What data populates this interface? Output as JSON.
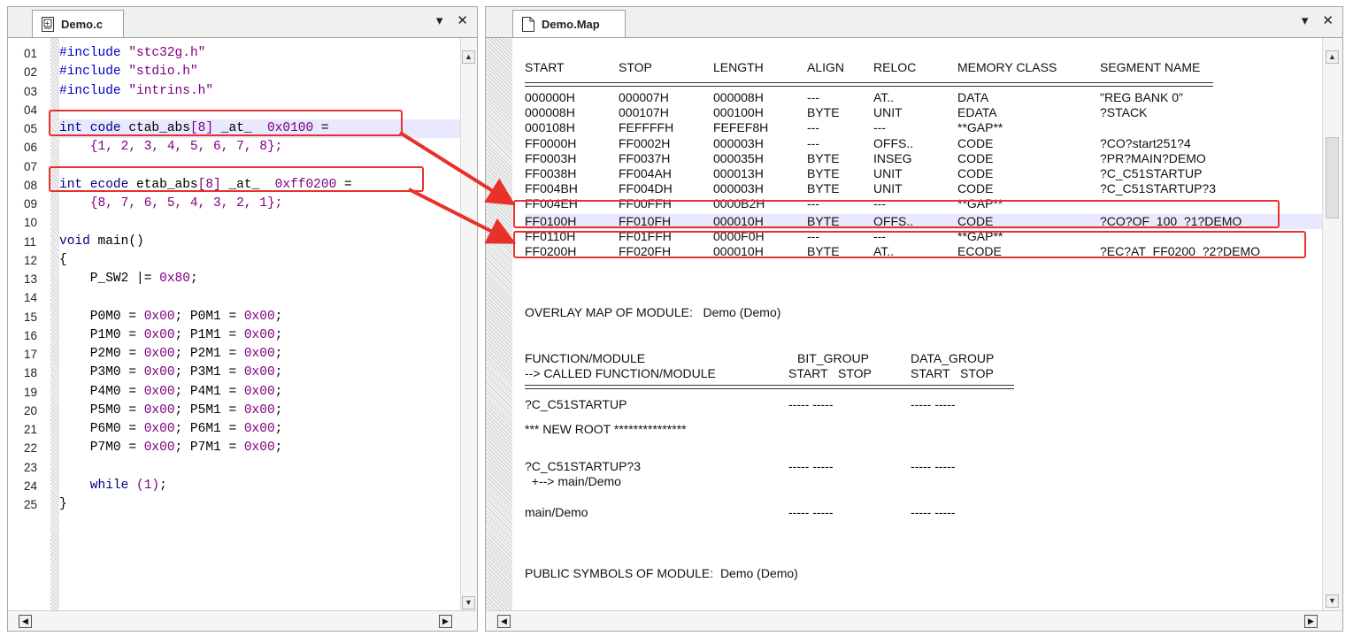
{
  "left_pane": {
    "tab_title": "Demo.c",
    "code_lines": [
      {
        "n": "01",
        "parts": [
          [
            "pp",
            "#include "
          ],
          [
            "str",
            "\"stc32g.h\""
          ]
        ]
      },
      {
        "n": "02",
        "parts": [
          [
            "pp",
            "#include "
          ],
          [
            "str",
            "\"stdio.h\""
          ]
        ]
      },
      {
        "n": "03",
        "parts": [
          [
            "pp",
            "#include "
          ],
          [
            "str",
            "\"intrins.h\""
          ]
        ]
      },
      {
        "n": "04",
        "parts": []
      },
      {
        "n": "05",
        "parts": [
          [
            "kw",
            "int code "
          ],
          [
            "",
            "ctab_abs"
          ],
          [
            "num",
            "[8]"
          ],
          [
            "",
            " _at_ "
          ],
          [
            "num",
            " 0x0100"
          ],
          [
            "",
            " ="
          ]
        ]
      },
      {
        "n": "06",
        "parts": [
          [
            "",
            "    "
          ],
          [
            "num",
            "{1, 2, 3, 4, 5, 6, 7, 8};"
          ]
        ]
      },
      {
        "n": "07",
        "parts": []
      },
      {
        "n": "08",
        "parts": [
          [
            "kw",
            "int ecode "
          ],
          [
            "",
            "etab_abs"
          ],
          [
            "num",
            "[8]"
          ],
          [
            "",
            " _at_ "
          ],
          [
            "num",
            " 0xff0200"
          ],
          [
            "",
            " ="
          ]
        ]
      },
      {
        "n": "09",
        "parts": [
          [
            "",
            "    "
          ],
          [
            "num",
            "{8, 7, 6, 5, 4, 3, 2, 1};"
          ]
        ]
      },
      {
        "n": "10",
        "parts": []
      },
      {
        "n": "11",
        "parts": [
          [
            "kw",
            "void "
          ],
          [
            "",
            "main()"
          ]
        ]
      },
      {
        "n": "12",
        "parts": [
          [
            "",
            "{"
          ]
        ]
      },
      {
        "n": "13",
        "parts": [
          [
            "",
            "    P_SW2 |= "
          ],
          [
            "num",
            "0x80"
          ],
          [
            "",
            ";"
          ]
        ]
      },
      {
        "n": "14",
        "parts": []
      },
      {
        "n": "15",
        "parts": [
          [
            "",
            "    P0M0 = "
          ],
          [
            "num",
            "0x00"
          ],
          [
            "",
            "; P0M1 = "
          ],
          [
            "num",
            "0x00"
          ],
          [
            "",
            ";"
          ]
        ]
      },
      {
        "n": "16",
        "parts": [
          [
            "",
            "    P1M0 = "
          ],
          [
            "num",
            "0x00"
          ],
          [
            "",
            "; P1M1 = "
          ],
          [
            "num",
            "0x00"
          ],
          [
            "",
            ";"
          ]
        ]
      },
      {
        "n": "17",
        "parts": [
          [
            "",
            "    P2M0 = "
          ],
          [
            "num",
            "0x00"
          ],
          [
            "",
            "; P2M1 = "
          ],
          [
            "num",
            "0x00"
          ],
          [
            "",
            ";"
          ]
        ]
      },
      {
        "n": "18",
        "parts": [
          [
            "",
            "    P3M0 = "
          ],
          [
            "num",
            "0x00"
          ],
          [
            "",
            "; P3M1 = "
          ],
          [
            "num",
            "0x00"
          ],
          [
            "",
            ";"
          ]
        ]
      },
      {
        "n": "19",
        "parts": [
          [
            "",
            "    P4M0 = "
          ],
          [
            "num",
            "0x00"
          ],
          [
            "",
            "; P4M1 = "
          ],
          [
            "num",
            "0x00"
          ],
          [
            "",
            ";"
          ]
        ]
      },
      {
        "n": "20",
        "parts": [
          [
            "",
            "    P5M0 = "
          ],
          [
            "num",
            "0x00"
          ],
          [
            "",
            "; P5M1 = "
          ],
          [
            "num",
            "0x00"
          ],
          [
            "",
            ";"
          ]
        ]
      },
      {
        "n": "21",
        "parts": [
          [
            "",
            "    P6M0 = "
          ],
          [
            "num",
            "0x00"
          ],
          [
            "",
            "; P6M1 = "
          ],
          [
            "num",
            "0x00"
          ],
          [
            "",
            ";"
          ]
        ]
      },
      {
        "n": "22",
        "parts": [
          [
            "",
            "    P7M0 = "
          ],
          [
            "num",
            "0x00"
          ],
          [
            "",
            "; P7M1 = "
          ],
          [
            "num",
            "0x00"
          ],
          [
            "",
            ";"
          ]
        ]
      },
      {
        "n": "23",
        "parts": []
      },
      {
        "n": "24",
        "parts": [
          [
            "kw",
            "    while "
          ],
          [
            "num",
            "(1)"
          ],
          [
            "",
            ";"
          ]
        ]
      },
      {
        "n": "25",
        "parts": [
          [
            "",
            "}"
          ]
        ]
      }
    ]
  },
  "right_pane": {
    "tab_title": "Demo.Map",
    "headers": [
      "START",
      "STOP",
      "LENGTH",
      "ALIGN",
      "RELOC",
      "MEMORY CLASS",
      "SEGMENT NAME"
    ],
    "rows": [
      [
        "000000H",
        "000007H",
        "000008H",
        "---",
        "AT..",
        "DATA",
        "\"REG BANK 0\""
      ],
      [
        "000008H",
        "000107H",
        "000100H",
        "BYTE",
        "UNIT",
        "EDATA",
        "?STACK"
      ],
      [
        "000108H",
        "FEFFFFH",
        "FEFEF8H",
        "---",
        "---",
        "**GAP**",
        ""
      ],
      [
        "FF0000H",
        "FF0002H",
        "000003H",
        "---",
        "OFFS..",
        "CODE",
        "?CO?start251?4"
      ],
      [
        "FF0003H",
        "FF0037H",
        "000035H",
        "BYTE",
        "INSEG",
        "CODE",
        "?PR?MAIN?DEMO"
      ],
      [
        "FF0038H",
        "FF004AH",
        "000013H",
        "BYTE",
        "UNIT",
        "CODE",
        "?C_C51STARTUP"
      ],
      [
        "FF004BH",
        "FF004DH",
        "000003H",
        "BYTE",
        "UNIT",
        "CODE",
        "?C_C51STARTUP?3"
      ],
      [
        "FF004EH",
        "FF00FFH",
        "0000B2H",
        "---",
        "---",
        "**GAP**",
        ""
      ],
      [
        "FF0100H",
        "FF010FH",
        "000010H",
        "BYTE",
        "OFFS..",
        "CODE",
        "?CO?OF_100_?1?DEMO"
      ],
      [
        "FF0110H",
        "FF01FFH",
        "0000F0H",
        "---",
        "---",
        "**GAP**",
        ""
      ],
      [
        "FF0200H",
        "FF020FH",
        "000010H",
        "BYTE",
        "AT..",
        "ECODE",
        "?EC?AT_FF0200_?2?DEMO"
      ]
    ],
    "overlay_title": "OVERLAY MAP OF MODULE:   Demo (Demo)",
    "fn_header_1": "FUNCTION/MODULE",
    "fn_header_1b": "BIT_GROUP",
    "fn_header_1c": "DATA_GROUP",
    "fn_header_2": "--> CALLED FUNCTION/MODULE",
    "fn_header_2b": "START   STOP",
    "fn_header_2c": "START   STOP",
    "fn_rows": [
      {
        "name": "?C_C51STARTUP",
        "a": "----- -----",
        "b": "----- -----"
      },
      {
        "name": "*** NEW ROOT ***************",
        "a": "",
        "b": ""
      },
      {
        "name": "?C_C51STARTUP?3",
        "a": "----- -----",
        "b": "----- -----"
      },
      {
        "name": "  +--> main/Demo",
        "a": "",
        "b": ""
      },
      {
        "name": "main/Demo",
        "a": "----- -----",
        "b": "----- -----"
      }
    ],
    "public_title": "PUBLIC SYMBOLS OF MODULE:  Demo (Demo)"
  },
  "colors": {
    "highlight_box": "#e8312b",
    "arrow": "#e8312b",
    "line_highlight": "#e8e8ff"
  }
}
